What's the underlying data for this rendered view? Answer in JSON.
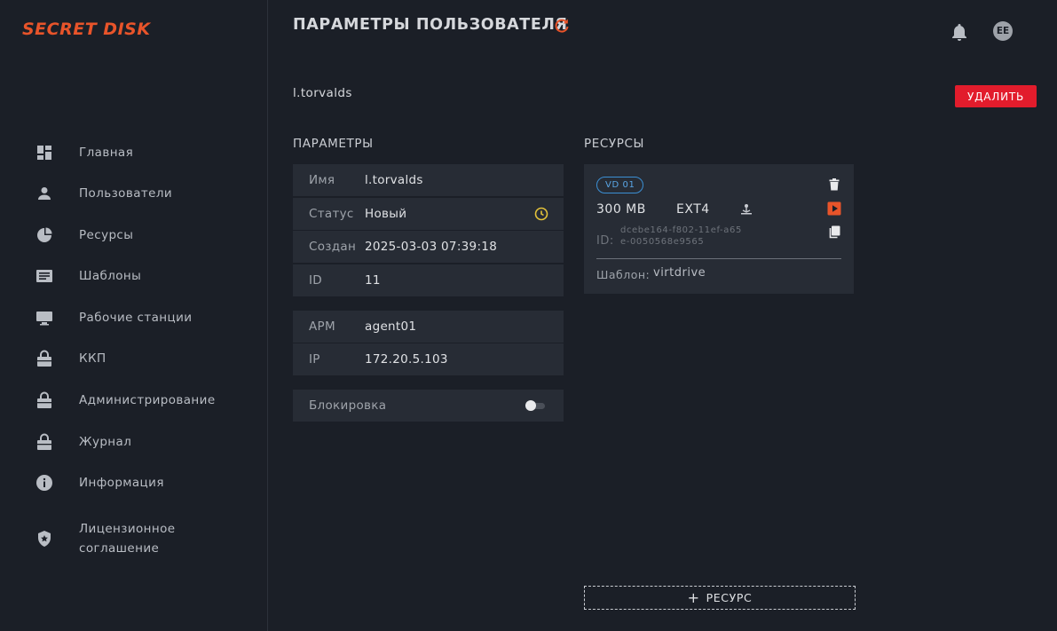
{
  "app": {
    "logo": "SECRET DISK",
    "accent": "#e8542a"
  },
  "sidebar": {
    "items": [
      {
        "label": "Главная",
        "icon": "dashboard-icon"
      },
      {
        "label": "Пользователи",
        "icon": "user-icon"
      },
      {
        "label": "Ресурсы",
        "icon": "pie-chart-icon"
      },
      {
        "label": "Шаблоны",
        "icon": "template-icon"
      },
      {
        "label": "Рабочие станции",
        "icon": "monitor-icon"
      },
      {
        "label": "ККП",
        "icon": "lock-icon"
      },
      {
        "label": "Администрирование",
        "icon": "lock-icon"
      },
      {
        "label": "Журнал",
        "icon": "lock-icon"
      },
      {
        "label": "Информация",
        "icon": "info-icon"
      },
      {
        "label": "Лицензионное соглашение",
        "icon": "shield-star-icon"
      }
    ]
  },
  "header": {
    "title": "ПАРАМЕТРЫ ПОЛЬЗОВАТЕЛЯ",
    "avatar": "EE"
  },
  "user": {
    "name": "l.torvalds",
    "delete_label": "УДАЛИТЬ",
    "delete_color": "#e21c2c"
  },
  "params": {
    "title": "ПАРАМЕТРЫ",
    "rows": [
      {
        "key": "Имя",
        "value": "l.torvalds"
      },
      {
        "key": "Статус",
        "value": "Новый"
      },
      {
        "key": "Создан",
        "value": "2025-03-03 07:39:18"
      },
      {
        "key": "ID",
        "value": "11"
      }
    ],
    "station_rows": [
      {
        "key": "АРМ",
        "value": "agent01"
      },
      {
        "key": "IP",
        "value": "172.20.5.103"
      }
    ],
    "block_label": "Блокировка",
    "block_enabled": false
  },
  "resources": {
    "title": "РЕСУРСЫ",
    "items": [
      {
        "badge": "VD 01",
        "size": "300 MB",
        "fs": "EXT4",
        "id_label": "ID:",
        "id": "dcebe164-f802-11ef-a65e-0050568e9565",
        "template_label": "Шаблон:",
        "template": "virtdrive"
      }
    ],
    "add_label": "РЕСУРС"
  }
}
